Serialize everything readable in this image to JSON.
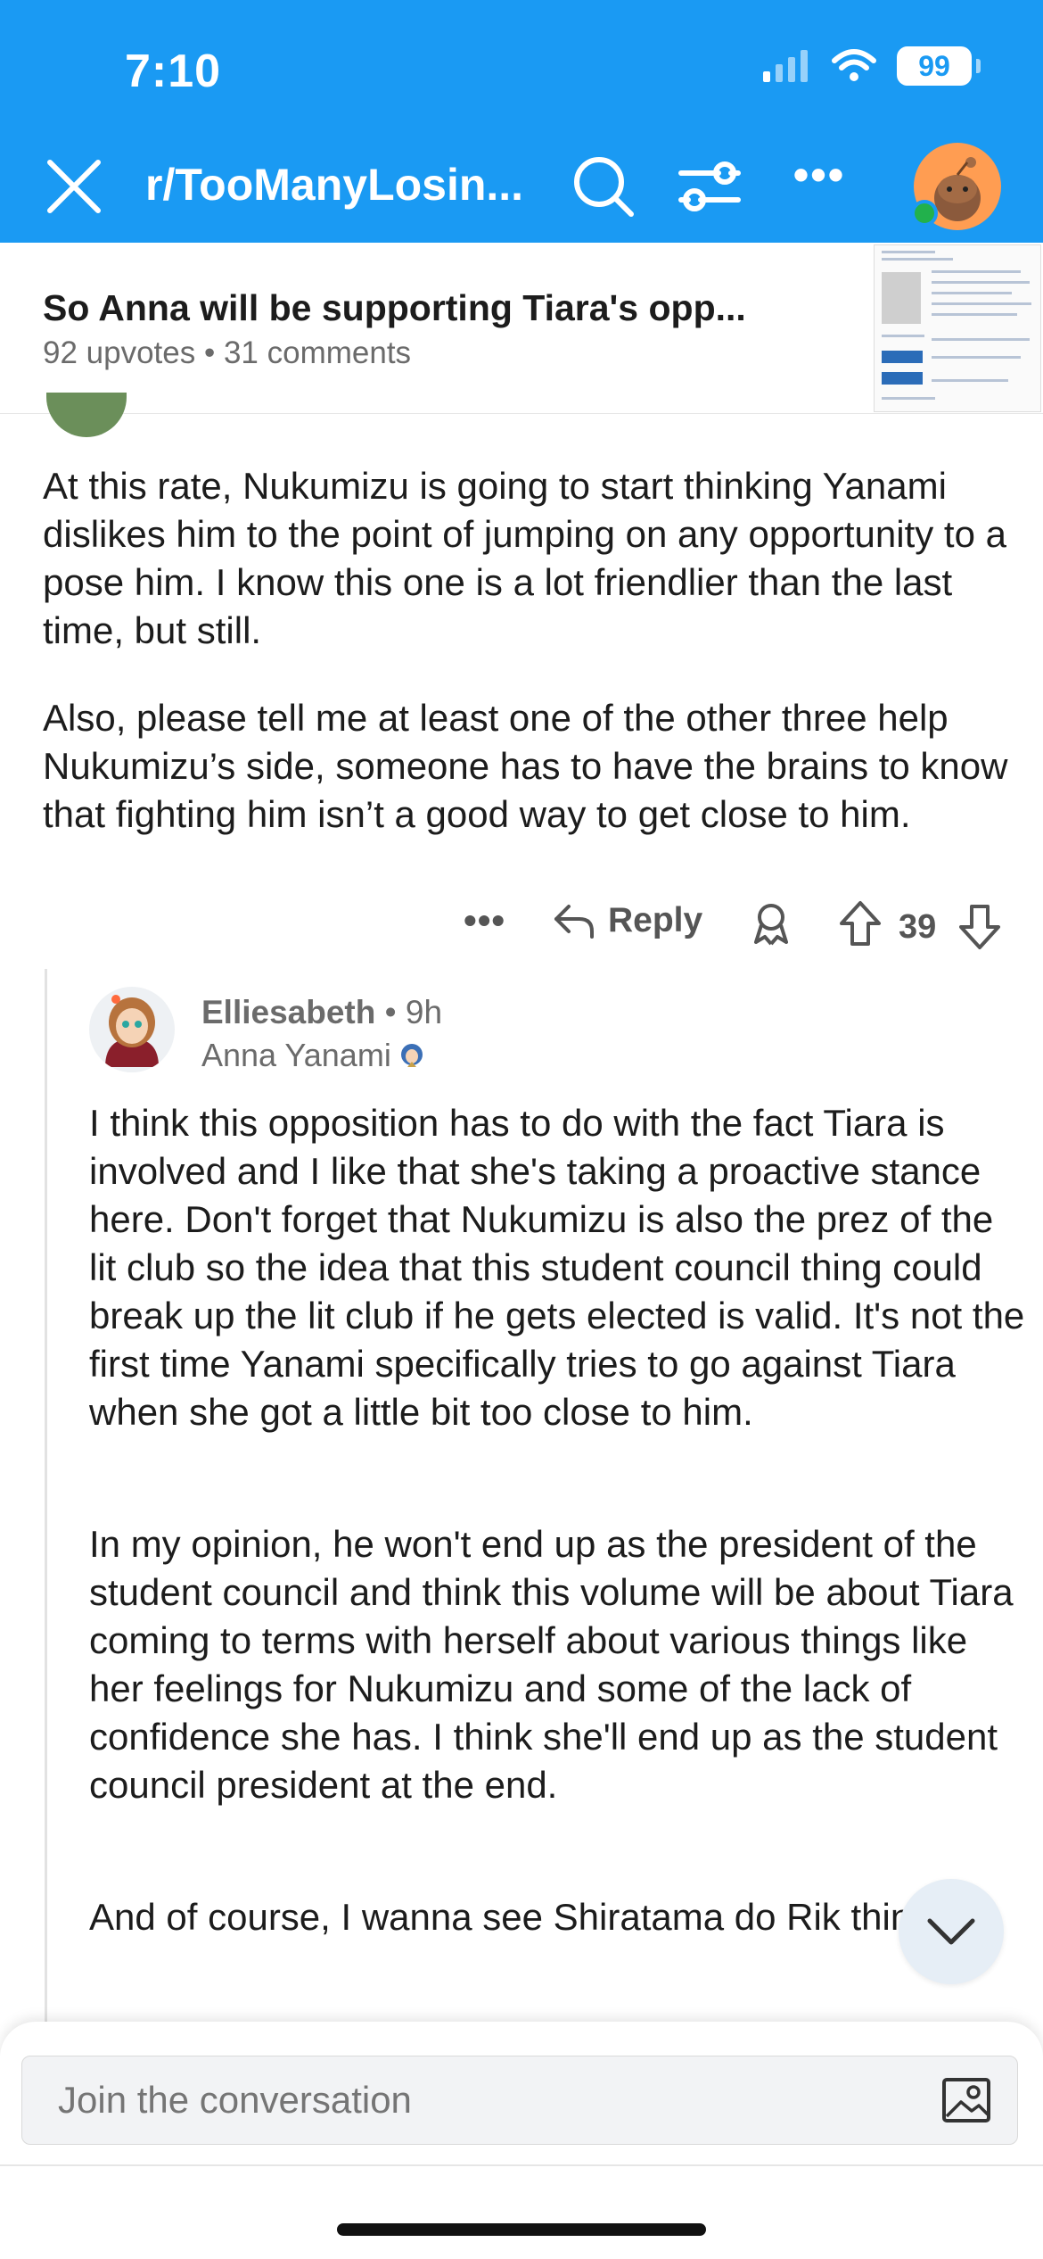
{
  "status_bar": {
    "time": "7:10",
    "battery": "99"
  },
  "nav": {
    "subreddit": "r/TooManyLosin..."
  },
  "post": {
    "title": "So Anna will be supporting Tiara's opp...",
    "upvotes": "92 upvotes",
    "comments": "31 comments"
  },
  "comment1": {
    "paragraphs": [
      "At this rate, Nukumizu is going to start thinking Yanami dislikes him to the point of jumping on any opportunity to a pose him. I know this one is a lot friendlier than the last time, but still.",
      "Also, please tell me at least one of the other three help Nukumizu’s side, someone has to have the brains to know that fighting him isn’t a good way to get close to him."
    ],
    "reply_label": "Reply",
    "score": "39"
  },
  "comment2": {
    "username": "Elliesabeth",
    "time": "9h",
    "flair": "Anna Yanami",
    "paragraphs": [
      "I think this opposition has to do with the fact Tiara is involved and I like that she's taking a proactive stance here. Don't forget that Nukumizu is also the prez of the lit club so the idea that this student council thing could break up the lit club if he gets elected is valid. It's not the first time Yanami specifically tries to go against Tiara when she got a little bit too close to him.",
      "In my opinion, he won't end up as the president of the student council and think this volume will be about Tiara coming to terms with herself about various things like her feelings for Nukumizu and some of the lack of confidence she has. I think she'll end up as the student council president at the end.",
      "And of course, I wanna see Shiratama do Rik things."
    ]
  },
  "composer": {
    "placeholder": "Join the conversation"
  },
  "colors": {
    "brand_blue": "#1a9af3",
    "online_green": "#22b14c",
    "avatar_orange": "#ff9d52"
  }
}
